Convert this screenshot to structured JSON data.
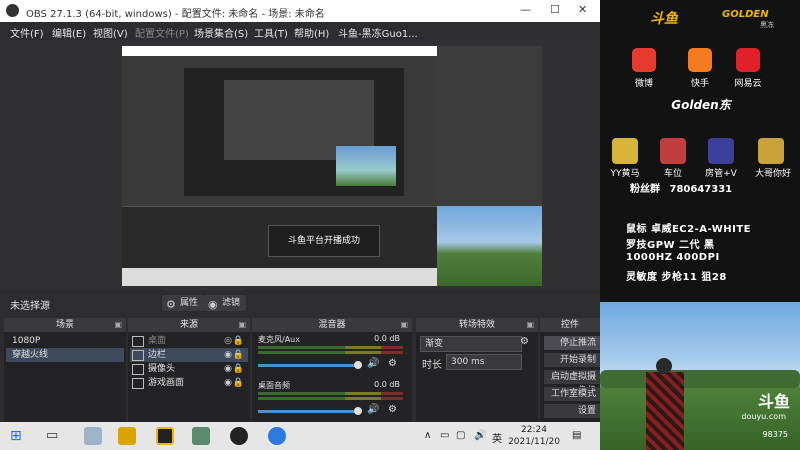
{
  "window": {
    "title": "OBS 27.1.3 (64-bit, windows) - 配置文件: 未命名 - 场景: 未命名",
    "controls": [
      "—",
      "☐",
      "✕"
    ]
  },
  "menu": [
    "文件(F)",
    "编辑(E)",
    "视图(V)",
    "配置文件(P)",
    "场景集合(S)",
    "工具(T)",
    "帮助(H)",
    "斗鱼-黑冻Guo1..."
  ],
  "preview": {
    "toast": "斗鱼平台开播成功"
  },
  "source_toolbar": {
    "no_source": "未选择源",
    "properties": "属性",
    "filters": "滤镜"
  },
  "scenes": {
    "header": "场景",
    "items": [
      "1080P",
      "穿越火线"
    ]
  },
  "sources": {
    "header": "来源",
    "items": [
      "桌面",
      "边栏",
      "摄像头",
      "游戏画面"
    ]
  },
  "mixer": {
    "header": "混音器",
    "channels": [
      {
        "name": "麦克风/Aux",
        "db": "0.0 dB"
      },
      {
        "name": "桌面音频",
        "db": "0.0 dB"
      }
    ]
  },
  "transitions": {
    "header": "转场特效",
    "type": "渐变",
    "duration_label": "时长",
    "duration_value": "300 ms"
  },
  "controls": {
    "header": "控件",
    "buttons": [
      "停止推流",
      "开始录制",
      "启动虚拟摄像机",
      "工作室模式",
      "设置"
    ]
  },
  "taskbar": {
    "time": "22:24",
    "date": "2021/11/20",
    "ime": "英"
  },
  "overlay": {
    "brand": "斗鱼",
    "golden": "GOLDEN",
    "golden_sub": "黑冻",
    "apps": [
      "微博",
      "快手",
      "网易云"
    ],
    "name": "Golden东",
    "badges": [
      "YY黄马",
      "车位",
      "房管+V",
      "大哥你好"
    ],
    "fans_label": "粉丝群",
    "fans_number": "780647331",
    "specs": [
      "鼠标  卓威EC2-A-WHITE",
      "   罗技GPW 二代 黑",
      "   1000HZ 400DPI",
      "   灵敏度 步枪11 狙28"
    ]
  },
  "photo": {
    "watermark": "斗鱼",
    "watermark_sub": "douyu.com",
    "id": "98375"
  },
  "colors": {
    "obs_bg": "#2d2d30",
    "dock_bg": "#232326",
    "accent_blue": "#4a8fd0",
    "brand_gold": "#f0b400"
  }
}
